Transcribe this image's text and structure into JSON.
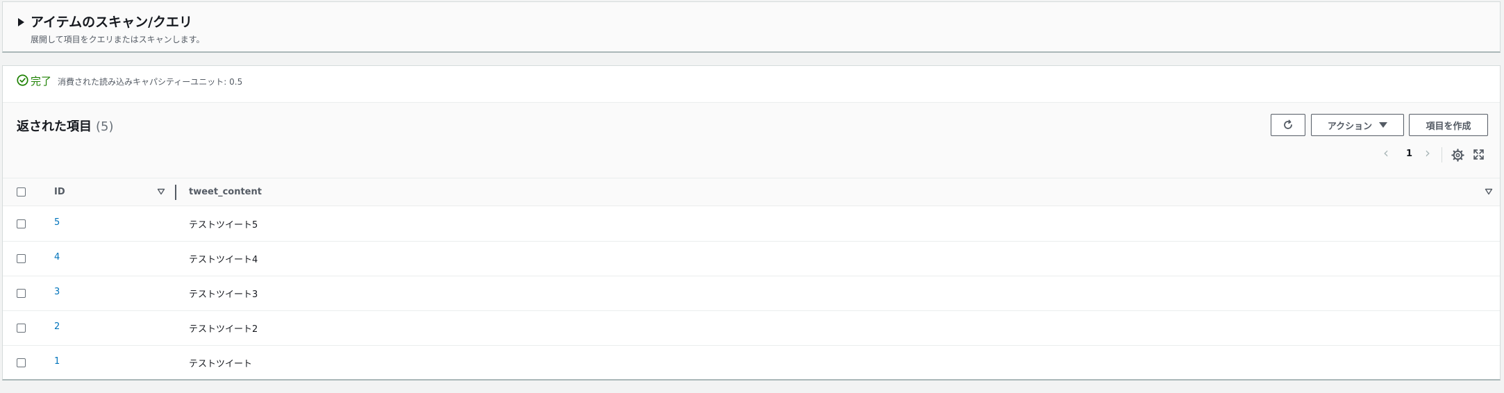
{
  "scan_panel": {
    "title": "アイテムのスキャン/クエリ",
    "description": "展開して項目をクエリまたはスキャンします。"
  },
  "status": {
    "state": "完了",
    "capacity": "消費された読み込みキャパシティーユニット: 0.5",
    "color": "#1d8102"
  },
  "items_header": {
    "title": "返された項目",
    "count": "(5)",
    "refresh_icon": "refresh-icon",
    "action_label": "アクション",
    "create_label": "項目を作成"
  },
  "pagination": {
    "current_page": "1"
  },
  "table": {
    "columns": [
      "ID",
      "tweet_content"
    ],
    "rows": [
      {
        "id": "5",
        "tweet_content": "テストツイート5"
      },
      {
        "id": "4",
        "tweet_content": "テストツイート4"
      },
      {
        "id": "3",
        "tweet_content": "テストツイート3"
      },
      {
        "id": "2",
        "tweet_content": "テストツイート2"
      },
      {
        "id": "1",
        "tweet_content": "テストツイート"
      }
    ]
  },
  "colors": {
    "link": "#0073bb",
    "text": "#16191f",
    "muted": "#545b64"
  }
}
